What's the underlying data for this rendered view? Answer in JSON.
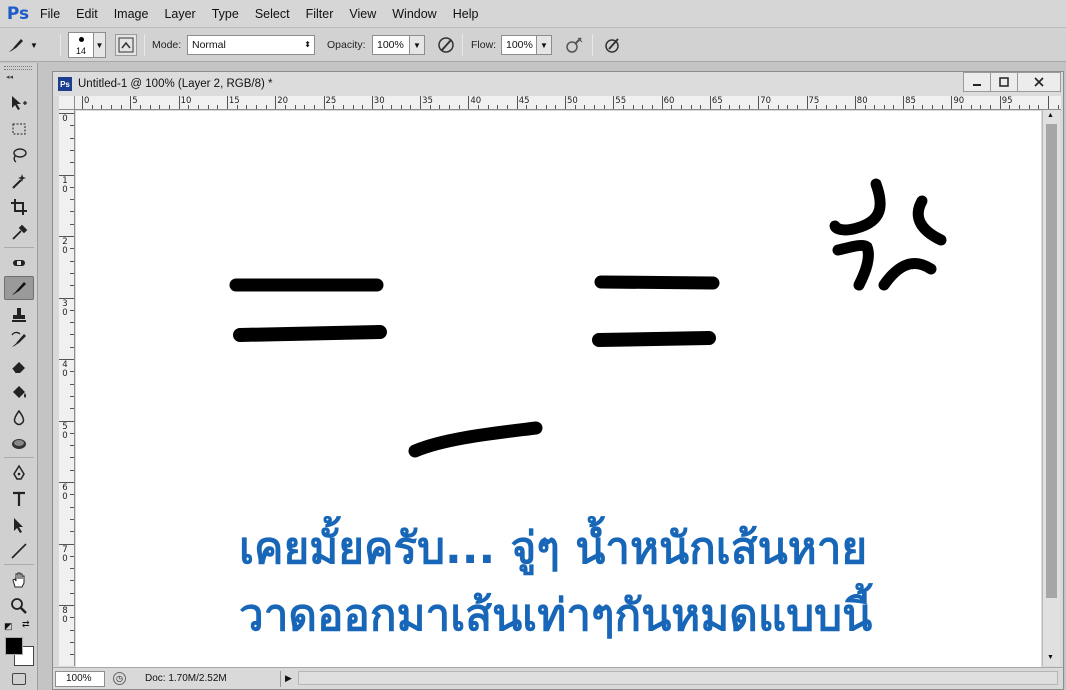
{
  "app": {
    "logo": "Ps"
  },
  "menu": [
    "File",
    "Edit",
    "Image",
    "Layer",
    "Type",
    "Select",
    "Filter",
    "View",
    "Window",
    "Help"
  ],
  "options": {
    "brush_size": "14",
    "mode_label": "Mode:",
    "mode_value": "Normal",
    "opacity_label": "Opacity:",
    "opacity_value": "100%",
    "flow_label": "Flow:",
    "flow_value": "100%"
  },
  "tools": [
    "move-tool",
    "marquee-tool",
    "lasso-tool",
    "magic-wand-tool",
    "crop-tool",
    "eyedropper-tool",
    "healing-brush-tool",
    "brush-tool",
    "clone-stamp-tool",
    "history-brush-tool",
    "eraser-tool",
    "paint-bucket-tool",
    "blur-tool",
    "dodge-tool",
    "pen-tool",
    "type-tool",
    "path-selection-tool",
    "line-tool",
    "hand-tool",
    "zoom-tool"
  ],
  "colors": {
    "foreground": "#000000",
    "background": "#ffffff",
    "caption": "#1766b8"
  },
  "document": {
    "title": "Untitled-1 @ 100% (Layer 2, RGB/8) *",
    "icon": "Ps",
    "h_ruler": [
      "0",
      "5",
      "10",
      "15",
      "20",
      "25",
      "30",
      "35",
      "40",
      "45",
      "50",
      "55",
      "60",
      "65",
      "70",
      "75",
      "80",
      "85",
      "90",
      "95"
    ],
    "v_ruler": [
      "0",
      "1 0",
      "2 0",
      "3 0",
      "4 0",
      "5 0",
      "6 0",
      "7 0",
      "8 0"
    ],
    "caption_line1": "เคยมั้ยครับ... จู่ๆ น้ำหนักเส้นหาย",
    "caption_line2": "วาดออกมาเส้นเท่าๆกันหมดแบบนี้"
  },
  "status": {
    "zoom": "100%",
    "doc_info": "Doc: 1.70M/2.52M"
  }
}
